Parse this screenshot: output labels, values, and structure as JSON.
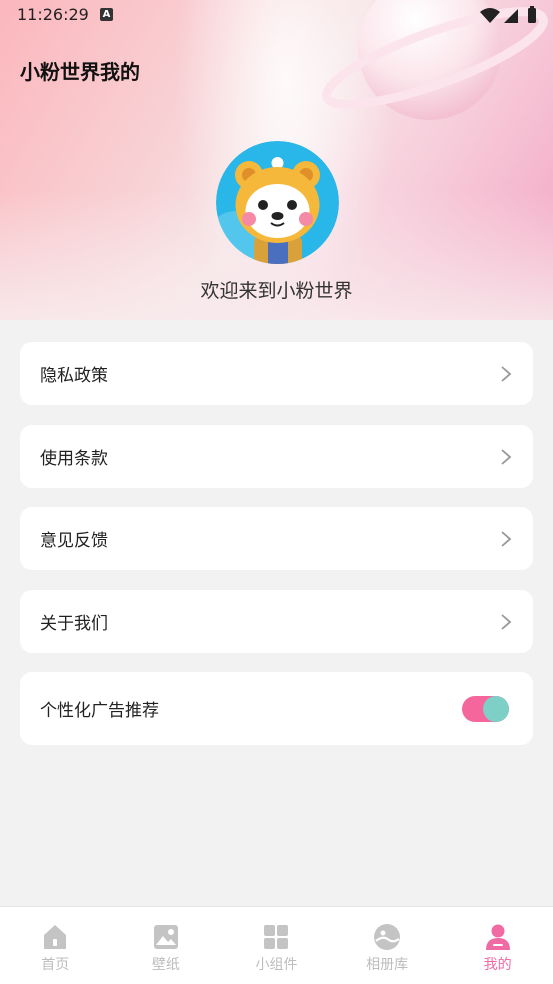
{
  "status_bar": {
    "time": "11:26:29",
    "notification_icon": "A"
  },
  "header": {
    "title": "小粉世界我的",
    "welcome": "欢迎来到小粉世界"
  },
  "menu": {
    "items": [
      {
        "label": "隐私政策",
        "icon": "chevron-right-icon"
      },
      {
        "label": "使用条款",
        "icon": "chevron-right-icon"
      },
      {
        "label": "意见反馈",
        "icon": "chevron-right-icon"
      },
      {
        "label": "关于我们",
        "icon": "chevron-right-icon"
      }
    ],
    "ad_toggle": {
      "label": "个性化广告推荐",
      "on": true
    }
  },
  "tabbar": {
    "tabs": [
      {
        "label": "首页",
        "icon": "home-icon"
      },
      {
        "label": "壁纸",
        "icon": "image-icon"
      },
      {
        "label": "小组件",
        "icon": "grid-icon"
      },
      {
        "label": "相册库",
        "icon": "album-icon"
      },
      {
        "label": "我的",
        "icon": "profile-icon",
        "active": true
      }
    ]
  },
  "colors": {
    "accent": "#f06ba3",
    "toggle_on": "#f5679c",
    "toggle_knob": "#7ecfc5",
    "inactive": "#bdbdbd"
  }
}
